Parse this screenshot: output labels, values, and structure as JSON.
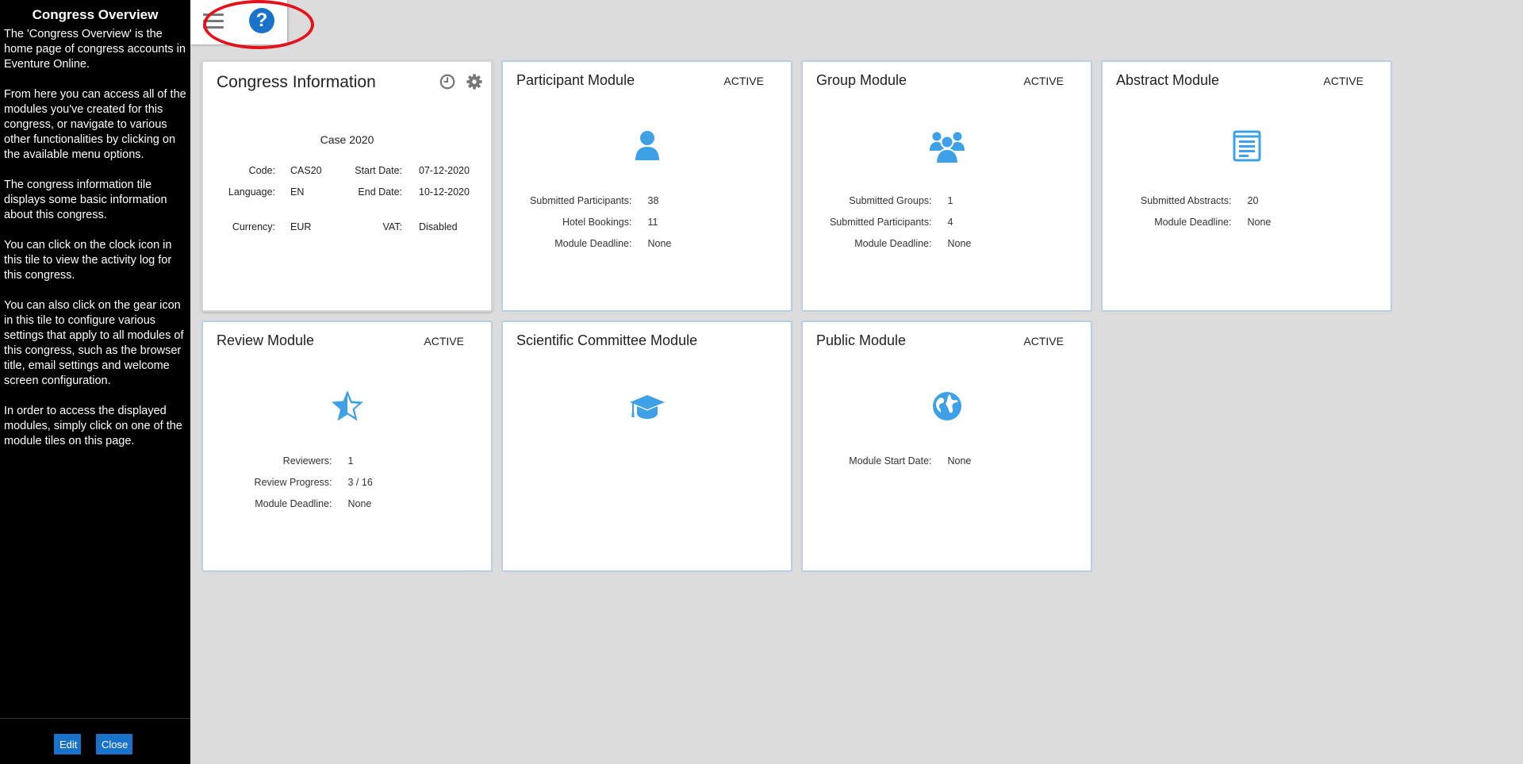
{
  "help": {
    "title": "Congress Overview",
    "paragraphs": [
      "The 'Congress Overview' is the home page of congress accounts in Eventure Online.",
      "From here you can access all of the modules you've created for this congress, or navigate to various other functionalities by clicking on the available menu options.",
      "The congress information tile displays some basic information about this congress.",
      "You can click on the clock icon in this tile to view the activity log for this congress.",
      "You can also click on the gear icon in this tile to configure various settings that apply to all modules of this congress, such as the browser title, email settings and welcome screen configuration.",
      "In order to access the displayed modules, simply click on one of the module tiles on this page."
    ],
    "edit_label": "Edit",
    "close_label": "Close"
  },
  "toolbar": {
    "help_glyph": "?",
    "menu_icon": "hamburger-icon",
    "help_icon": "question-circle-icon",
    "highlight_color": "#e3121b"
  },
  "congress": {
    "title": "Congress Information",
    "name": "Case 2020",
    "code_label": "Code:",
    "code": "CAS20",
    "start_label": "Start Date:",
    "start": "07-12-2020",
    "language_label": "Language:",
    "language": "EN",
    "end_label": "End Date:",
    "end": "10-12-2020",
    "currency_label": "Currency:",
    "currency": "EUR",
    "vat_label": "VAT:",
    "vat": "Disabled"
  },
  "modules": [
    {
      "title": "Participant Module",
      "status": "ACTIVE",
      "icon": "user-icon",
      "stats": [
        {
          "label": "Submitted Participants:",
          "value": "38"
        },
        {
          "label": "Hotel Bookings:",
          "value": "11"
        },
        {
          "label": "Module Deadline:",
          "value": "None"
        }
      ]
    },
    {
      "title": "Group Module",
      "status": "ACTIVE",
      "icon": "users-group-icon",
      "stats": [
        {
          "label": "Submitted Groups:",
          "value": "1"
        },
        {
          "label": "Submitted Participants:",
          "value": "4"
        },
        {
          "label": "Module Deadline:",
          "value": "None"
        }
      ]
    },
    {
      "title": "Abstract Module",
      "status": "ACTIVE",
      "icon": "document-icon",
      "stats": [
        {
          "label": "Submitted Abstracts:",
          "value": "20"
        },
        {
          "label": "Module Deadline:",
          "value": "None"
        }
      ]
    },
    {
      "title": "Review Module",
      "status": "ACTIVE",
      "icon": "star-icon",
      "stats": [
        {
          "label": "Reviewers:",
          "value": "1"
        },
        {
          "label": "Review Progress:",
          "value": "3 / 16"
        },
        {
          "label": "Module Deadline:",
          "value": "None"
        }
      ]
    },
    {
      "title": "Scientific Committee Module",
      "status": "",
      "icon": "graduation-cap-icon",
      "stats": []
    },
    {
      "title": "Public Module",
      "status": "ACTIVE",
      "icon": "globe-icon",
      "stats": [
        {
          "label": "Module Start Date:",
          "value": "None"
        }
      ]
    }
  ],
  "colors": {
    "accent": "#3ea0e6",
    "button": "#1a73c9",
    "tile_border": "#b8cde6"
  }
}
